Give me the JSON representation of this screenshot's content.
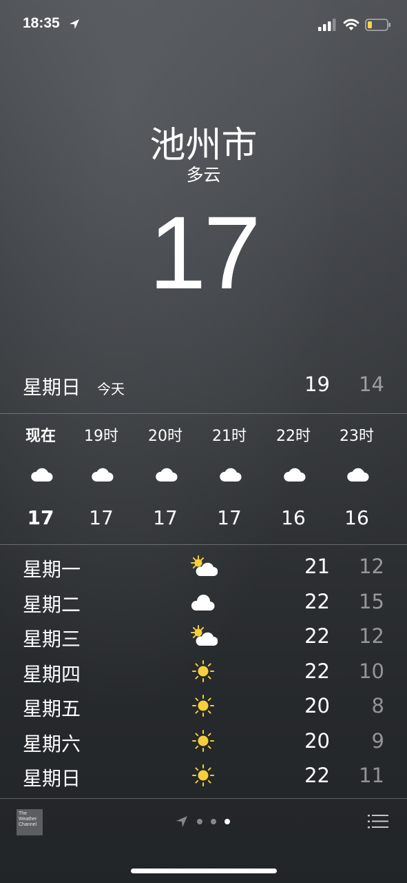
{
  "status_bar": {
    "time": "18:35",
    "icons": [
      "location-arrow-icon",
      "signal-icon",
      "wifi-icon",
      "battery-icon"
    ]
  },
  "current": {
    "city": "池州市",
    "condition": "多云",
    "temperature": "17"
  },
  "today": {
    "day": "星期日",
    "tag": "今天",
    "high": "19",
    "low": "14"
  },
  "hourly": [
    {
      "label": "现在",
      "icon": "cloud-icon",
      "temp": "17"
    },
    {
      "label": "19时",
      "icon": "cloud-icon",
      "temp": "17"
    },
    {
      "label": "20时",
      "icon": "cloud-icon",
      "temp": "17"
    },
    {
      "label": "21时",
      "icon": "cloud-icon",
      "temp": "17"
    },
    {
      "label": "22时",
      "icon": "cloud-icon",
      "temp": "16"
    },
    {
      "label": "23时",
      "icon": "cloud-icon",
      "temp": "16"
    }
  ],
  "daily": [
    {
      "day": "星期一",
      "icon": "partly-sunny-icon",
      "high": "21",
      "low": "12"
    },
    {
      "day": "星期二",
      "icon": "cloud-icon",
      "high": "22",
      "low": "15"
    },
    {
      "day": "星期三",
      "icon": "partly-sunny-icon",
      "high": "22",
      "low": "12"
    },
    {
      "day": "星期四",
      "icon": "sun-icon",
      "high": "22",
      "low": "10"
    },
    {
      "day": "星期五",
      "icon": "sun-icon",
      "high": "20",
      "low": "8"
    },
    {
      "day": "星期六",
      "icon": "sun-icon",
      "high": "20",
      "low": "9"
    },
    {
      "day": "星期日",
      "icon": "sun-icon",
      "high": "22",
      "low": "11"
    }
  ],
  "footer": {
    "logo_text": "The Weather Channel",
    "page_indicator": {
      "pages": 3,
      "current": 3
    }
  },
  "colors": {
    "sun": "#f6cf3a",
    "secondary_text": "rgba(255,255,255,0.5)"
  }
}
